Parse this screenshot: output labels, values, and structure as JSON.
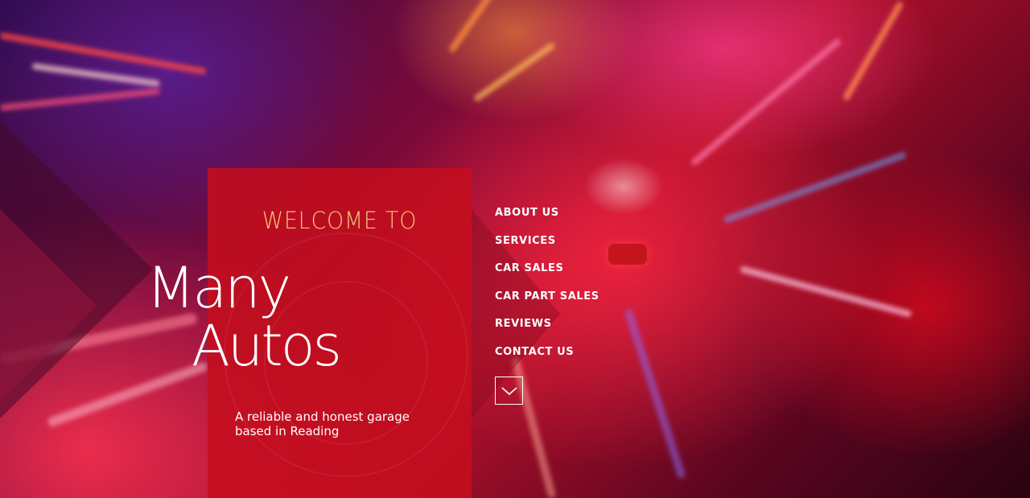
{
  "hero": {
    "welcome": "WELCOME TO",
    "brand_line1": "Many",
    "brand_line2": "Autos",
    "tagline": "A reliable and honest garage based in Reading"
  },
  "nav": {
    "items": [
      {
        "label": "ABOUT US"
      },
      {
        "label": "SERVICES"
      },
      {
        "label": "CAR SALES"
      },
      {
        "label": "CAR PART SALES"
      },
      {
        "label": "REVIEWS"
      },
      {
        "label": "CONTACT US"
      }
    ],
    "scroll_icon": "chevron-down-icon"
  },
  "colors": {
    "panel_red": "#c40e1e",
    "welcome_gold": "#f3c77a",
    "text_white": "#ffffff"
  }
}
